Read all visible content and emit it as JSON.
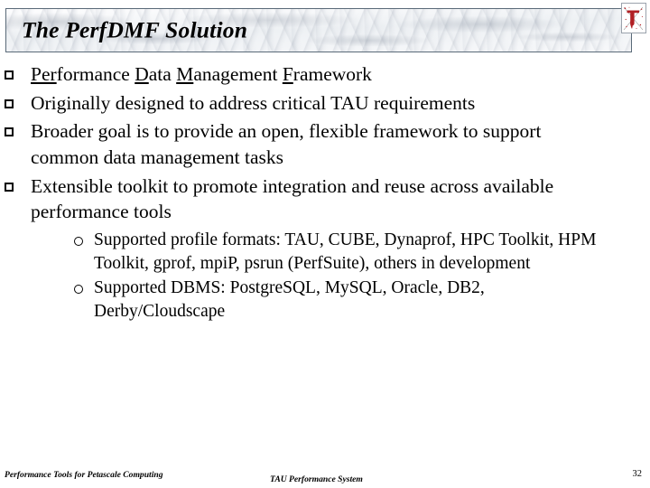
{
  "slide": {
    "title": "The PerfDMF Solution",
    "background_color": "#ffffff",
    "text_color": "#000000"
  },
  "logo": {
    "name": "tau-logo",
    "glyph": "τ",
    "color": "#b11f24",
    "border_color": "#9aa2ac"
  },
  "bullets": [
    {
      "marker": "hollow-square",
      "segments": [
        {
          "text": "Per",
          "underline": true
        },
        {
          "text": "formance ",
          "underline": false
        },
        {
          "text": "D",
          "underline": true
        },
        {
          "text": "ata ",
          "underline": false
        },
        {
          "text": "M",
          "underline": true
        },
        {
          "text": "anagement ",
          "underline": false
        },
        {
          "text": "F",
          "underline": true
        },
        {
          "text": "ramework",
          "underline": false
        }
      ],
      "plain_text": "Performance Data Management Framework"
    },
    {
      "marker": "hollow-square",
      "plain_text": "Originally designed to address critical TAU requirements"
    },
    {
      "marker": "hollow-square",
      "plain_text": "Broader goal is to provide an open, flexible framework to support common data management tasks"
    },
    {
      "marker": "hollow-square",
      "plain_text": "Extensible toolkit to promote integration and reuse across available performance tools"
    }
  ],
  "sub_bullets": [
    {
      "marker": "hollow-circle",
      "plain_text": "Supported profile formats:  TAU, CUBE, Dynaprof, HPC Toolkit, HPM Toolkit, gprof, mpiP, psrun (PerfSuite), others in development"
    },
    {
      "marker": "hollow-circle",
      "plain_text": "Supported DBMS:  PostgreSQL, MySQL, Oracle, DB2, Derby/Cloudscape"
    }
  ],
  "footer": {
    "left": "Performance Tools for Petascale Computing",
    "center": "TAU Performance System",
    "page_number": "32"
  }
}
